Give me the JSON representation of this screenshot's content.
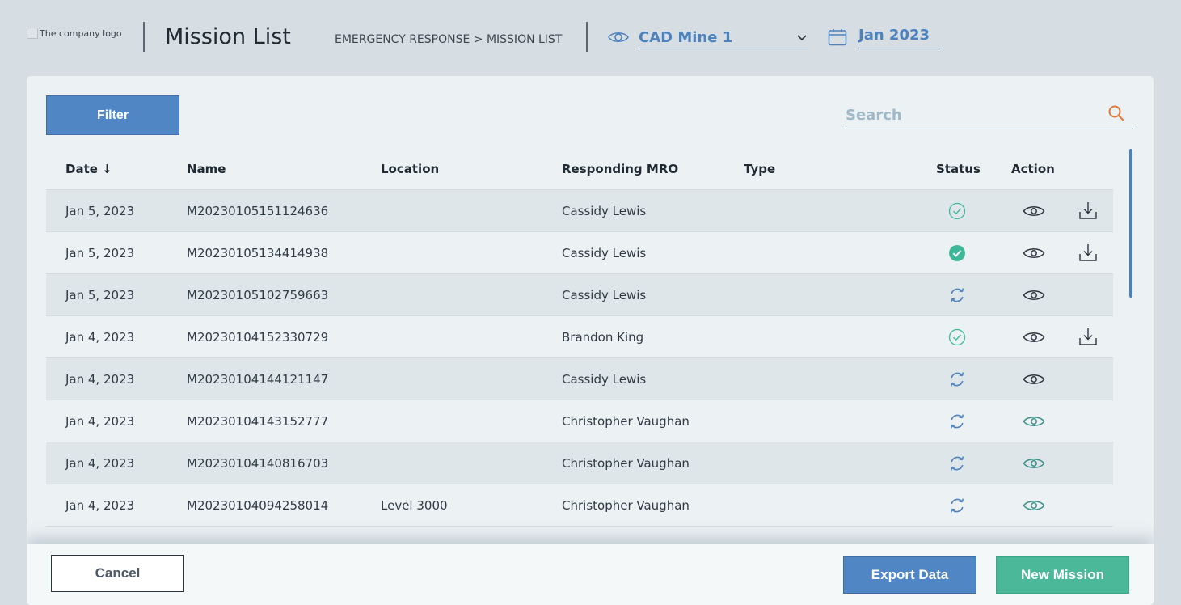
{
  "header": {
    "logo_text": "The company logo",
    "page_title": "Mission List",
    "breadcrumb": "EMERGENCY RESPONSE > MISSION LIST",
    "site_value": "CAD Mine 1",
    "date_value": "Jan 2023"
  },
  "toolbar": {
    "filter_label": "Filter",
    "search_placeholder": "Search"
  },
  "table": {
    "columns": {
      "date": "Date ↓",
      "name": "Name",
      "location": "Location",
      "mro": "Responding MRO",
      "type": "Type",
      "status": "Status",
      "action": "Action"
    },
    "rows": [
      {
        "date": "Jan 5, 2023",
        "name": "M20230105151124636",
        "location": "",
        "mro": "Cassidy Lewis",
        "type": "",
        "status": "complete-outline",
        "download": true
      },
      {
        "date": "Jan 5, 2023",
        "name": "M20230105134414938",
        "location": "",
        "mro": "Cassidy Lewis",
        "type": "",
        "status": "complete-filled",
        "download": true
      },
      {
        "date": "Jan 5, 2023",
        "name": "M20230105102759663",
        "location": "",
        "mro": "Cassidy Lewis",
        "type": "",
        "status": "in-progress",
        "download": false
      },
      {
        "date": "Jan 4, 2023",
        "name": "M20230104152330729",
        "location": "",
        "mro": "Brandon King",
        "type": "",
        "status": "complete-outline",
        "download": true
      },
      {
        "date": "Jan 4, 2023",
        "name": "M20230104144121147",
        "location": "",
        "mro": "Cassidy Lewis",
        "type": "",
        "status": "in-progress",
        "download": false
      },
      {
        "date": "Jan 4, 2023",
        "name": "M20230104143152777",
        "location": "",
        "mro": "Christopher Vaughan",
        "type": "",
        "status": "in-progress",
        "download": false
      },
      {
        "date": "Jan 4, 2023",
        "name": "M20230104140816703",
        "location": "",
        "mro": "Christopher Vaughan",
        "type": "",
        "status": "in-progress",
        "download": false
      },
      {
        "date": "Jan 4, 2023",
        "name": "M20230104094258014",
        "location": "Level 3000",
        "mro": "Christopher Vaughan",
        "type": "",
        "status": "in-progress",
        "download": false
      }
    ]
  },
  "footer": {
    "cancel_label": "Cancel",
    "export_label": "Export Data",
    "new_label": "New Mission"
  },
  "colors": {
    "primary_blue": "#5086c4",
    "accent_green": "#4cb89a",
    "status_green": "#3fb89a",
    "status_blue": "#4d82bd",
    "search_icon": "#e07a3c"
  },
  "icons": {
    "site": "eye-icon",
    "date": "calendar-icon",
    "search": "search-icon",
    "view": "eye-icon",
    "download": "download-icon"
  }
}
